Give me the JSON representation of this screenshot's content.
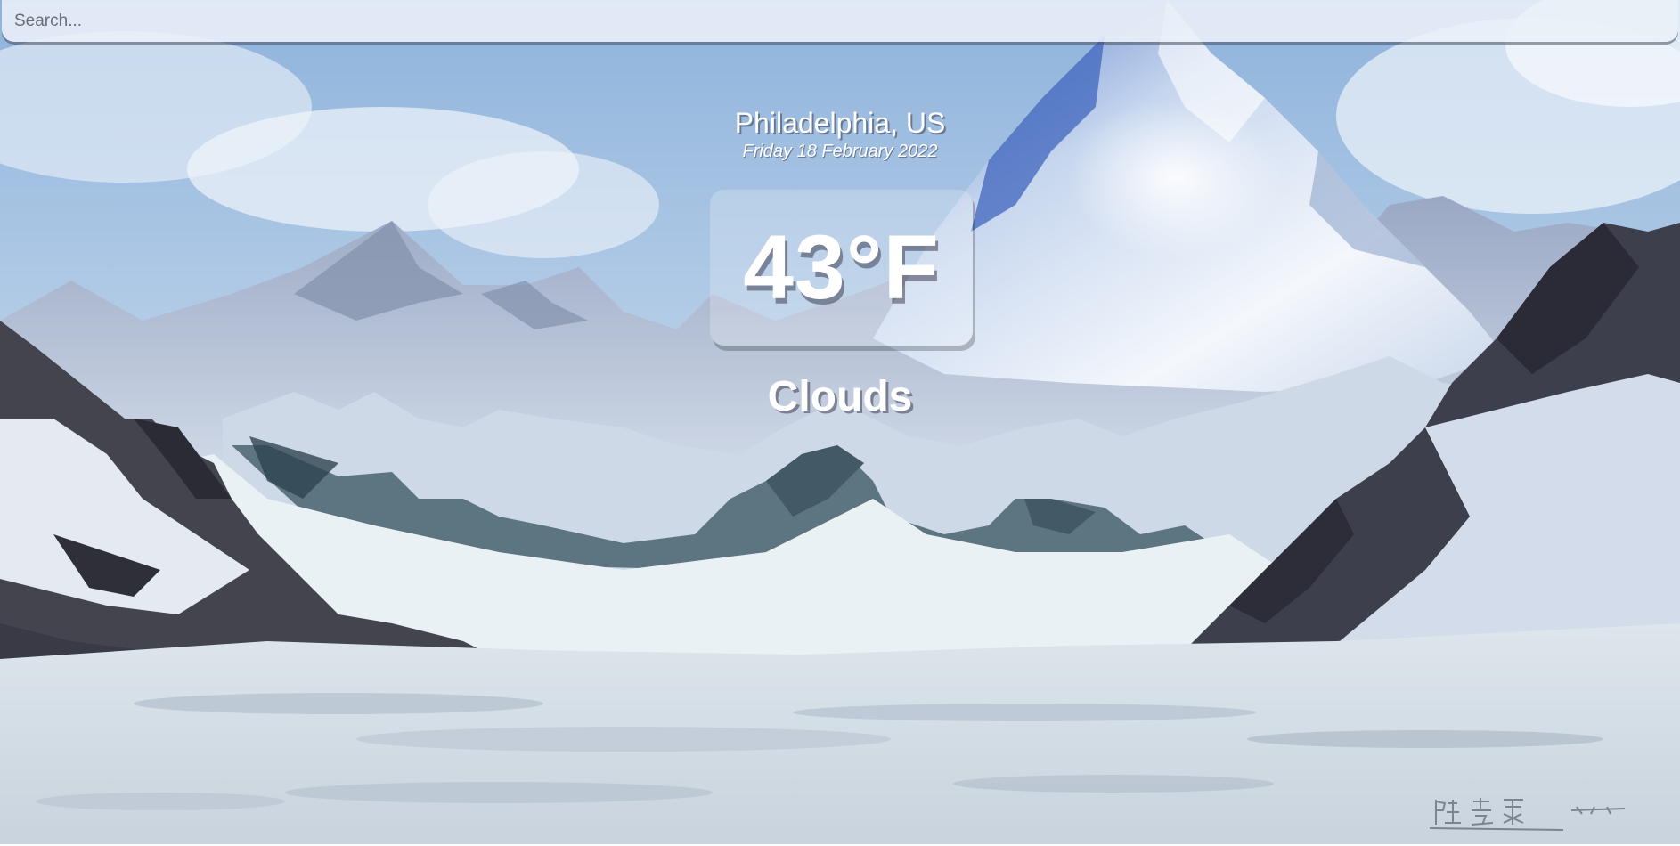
{
  "search": {
    "placeholder": "Search...",
    "value": ""
  },
  "location": {
    "city": "Philadelphia, US",
    "date": "Friday 18 February 2022"
  },
  "weather": {
    "temperature": "43°F",
    "condition": "Clouds"
  },
  "colors": {
    "sky_top": "#8fb3dc",
    "sky_bottom": "#dbe8f4",
    "snow": "#e6edf2",
    "rock_dark": "#3e3f4c",
    "rock_slate": "#58707c",
    "text": "#ffffff"
  }
}
